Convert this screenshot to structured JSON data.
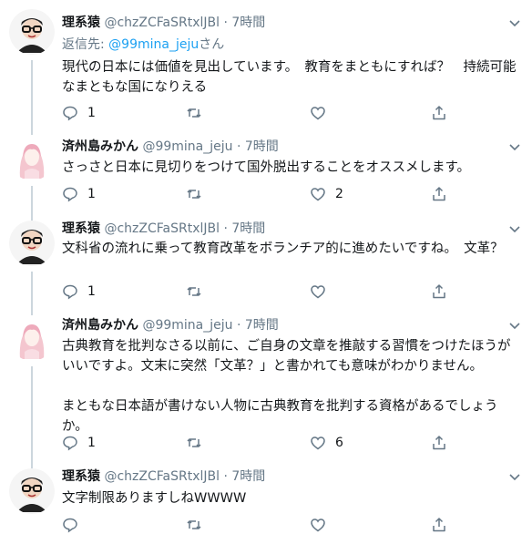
{
  "tweets": [
    {
      "name": "理系猿",
      "handle": "@chzZCFaSRtxlJBl",
      "dot": "·",
      "time": "7時間",
      "reply_prefix": "返信先: ",
      "reply_mention": "@99mina_jeju",
      "reply_suffix": "さん",
      "text": "現代の日本には価値を見出しています。　教育をまともにすれば？　持続可能なまともな国になりえる",
      "reply_count": "1",
      "retweet_count": "",
      "like_count": ""
    },
    {
      "name": "済州島みかん",
      "handle": "@99mina_jeju",
      "dot": "·",
      "time": "7時間",
      "text": "さっさと日本に見切りをつけて国外脱出することをオススメします。",
      "reply_count": "1",
      "retweet_count": "",
      "like_count": "2"
    },
    {
      "name": "理系猿",
      "handle": "@chzZCFaSRtxlJBl",
      "dot": "·",
      "time": "7時間",
      "text": "文科省の流れに乗って教育改革をボランチア的に進めたいですね。　文革？",
      "reply_count": "1",
      "retweet_count": "",
      "like_count": ""
    },
    {
      "name": "済州島みかん",
      "handle": "@99mina_jeju",
      "dot": "·",
      "time": "7時間",
      "text": "古典教育を批判なさる以前に、ご自身の文章を推敲する習慣をつけたほうがいいですよ。文末に突然「文革？」と書かれても意味がわかりません。\n\nまともな日本語が書けない人物に古典教育を批判する資格があるでしょうか。",
      "reply_count": "1",
      "retweet_count": "",
      "like_count": "6"
    },
    {
      "name": "理系猿",
      "handle": "@chzZCFaSRtxlJBl",
      "dot": "·",
      "time": "7時間",
      "text": "文字制限ありますしねWWWW",
      "reply_count": "",
      "retweet_count": "",
      "like_count": ""
    }
  ],
  "colors": {
    "text": "#14171a",
    "muted": "#657786",
    "link": "#1da1f2",
    "thread_line": "#ccd6dd"
  }
}
